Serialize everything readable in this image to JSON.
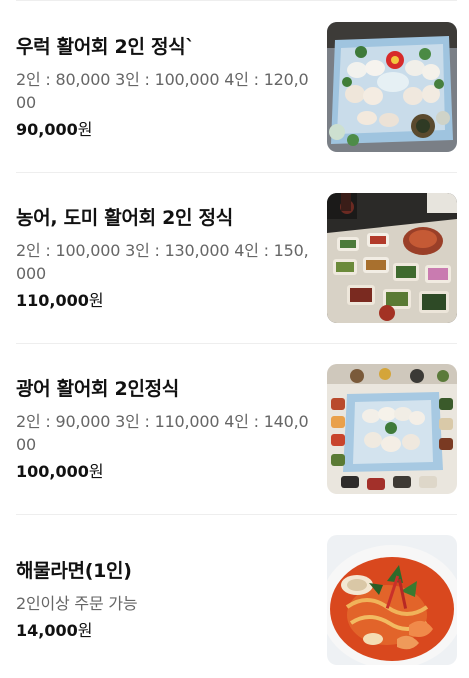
{
  "menu": {
    "items": [
      {
        "name": "우럭 활어회 2인 정식`",
        "description": "2인 : 80,000 3인 : 100,000 4인 : 120,000",
        "price_number": "90,000",
        "price_unit": "원",
        "image": "platter-of-sliced-raw-fish-photo"
      },
      {
        "name": "농어, 도미 활어회 2인 정식",
        "description": "2인 : 100,000 3인 : 130,000 4인 : 150,000",
        "price_number": "110,000",
        "price_unit": "원",
        "image": "table-of-side-dishes-photo"
      },
      {
        "name": "광어 활어회 2인정식",
        "description": "2인 : 90,000 3인 : 110,000 4인 : 140,000",
        "price_number": "100,000",
        "price_unit": "원",
        "image": "sashimi-platter-spread-photo"
      },
      {
        "name": "해물라면(1인)",
        "description": "2인이상 주문 가능",
        "price_number": "14,000",
        "price_unit": "원",
        "image": "seafood-ramen-bowl-photo"
      }
    ]
  }
}
